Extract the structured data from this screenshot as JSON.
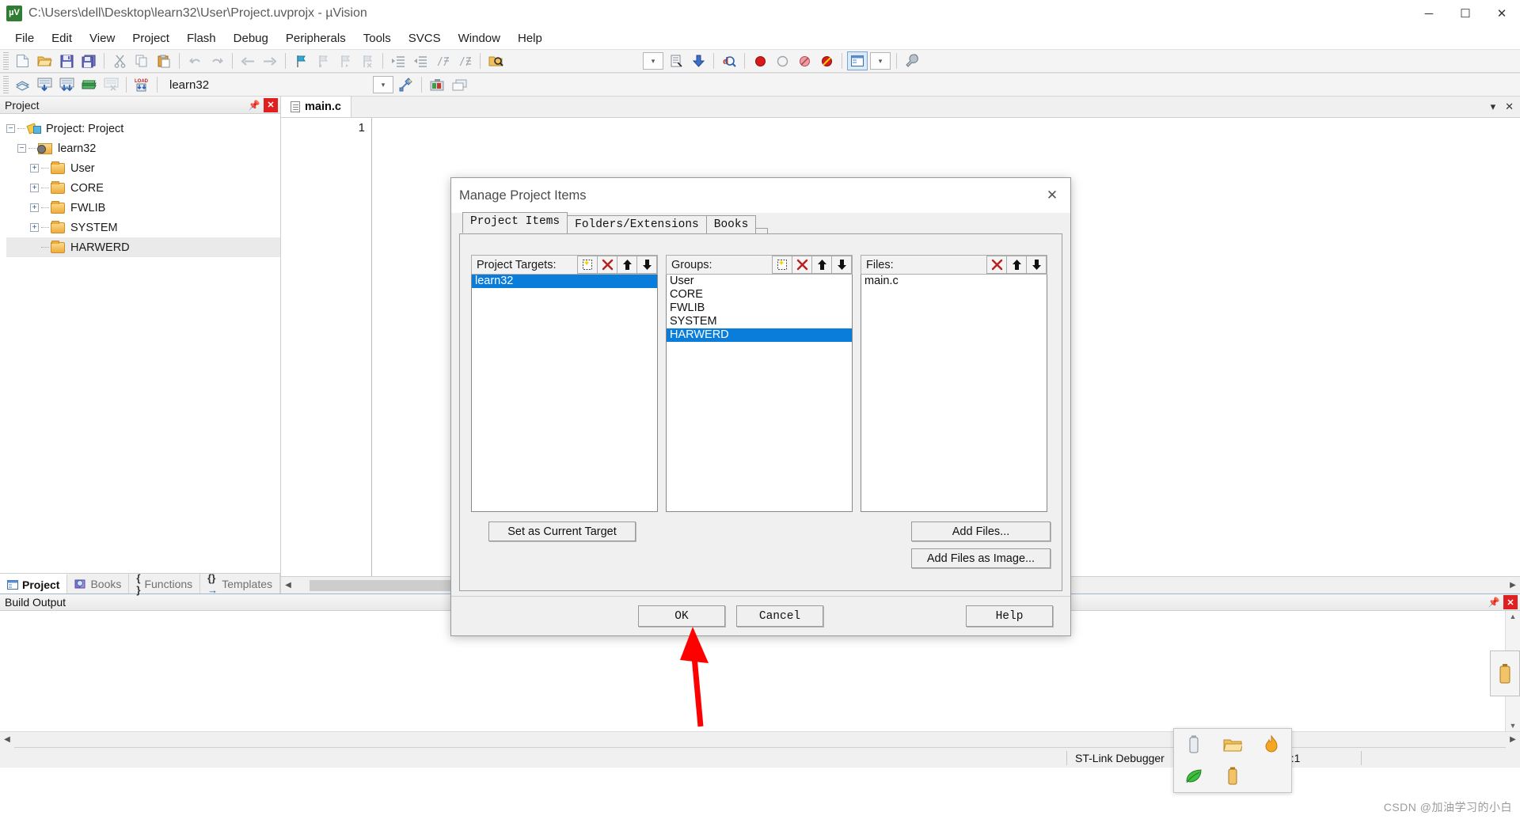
{
  "window": {
    "title": "C:\\Users\\dell\\Desktop\\learn32\\User\\Project.uvprojx - µVision",
    "app_icon": "uvision-icon",
    "minimize": "─",
    "maximize": "☐",
    "close": "✕"
  },
  "menu": {
    "items": [
      "File",
      "Edit",
      "View",
      "Project",
      "Flash",
      "Debug",
      "Peripherals",
      "Tools",
      "SVCS",
      "Window",
      "Help"
    ]
  },
  "toolbar2": {
    "target_value": "learn32"
  },
  "project_pane": {
    "title": "Project",
    "tree": [
      {
        "label": "Project: Project",
        "level": 0,
        "expander": "−",
        "icon": "project-icon",
        "selected": false
      },
      {
        "label": "learn32",
        "level": 1,
        "expander": "−",
        "icon": "target-icon",
        "selected": false
      },
      {
        "label": "User",
        "level": 2,
        "expander": "+",
        "icon": "folder-icon",
        "selected": false
      },
      {
        "label": "CORE",
        "level": 2,
        "expander": "+",
        "icon": "folder-icon",
        "selected": false
      },
      {
        "label": "FWLIB",
        "level": 2,
        "expander": "+",
        "icon": "folder-icon",
        "selected": false
      },
      {
        "label": "SYSTEM",
        "level": 2,
        "expander": "+",
        "icon": "folder-icon",
        "selected": false
      },
      {
        "label": "HARWERD",
        "level": 2,
        "expander": "",
        "icon": "folder-icon",
        "selected": true
      }
    ],
    "tabs": [
      {
        "label": "Project",
        "icon": "project-window-icon",
        "active": true
      },
      {
        "label": "Books",
        "icon": "books-icon",
        "active": false
      },
      {
        "label": "Functions",
        "icon": "braces-icon",
        "active": false
      },
      {
        "label": "Templates",
        "icon": "template-icon",
        "active": false
      }
    ]
  },
  "editor": {
    "tab_label": "main.c",
    "line_numbers": [
      "1"
    ],
    "code_lines": [
      ""
    ]
  },
  "build_output": {
    "title": "Build Output",
    "lines": []
  },
  "status_bar": {
    "debugger": "ST-Link Debugger",
    "position": "1 C:1"
  },
  "dialog": {
    "title": "Manage Project Items",
    "close_label": "✕",
    "tabs": [
      {
        "label": "Project Items",
        "active": true
      },
      {
        "label": "Folders/Extensions",
        "active": false
      },
      {
        "label": "Books",
        "active": false
      }
    ],
    "columns": [
      {
        "header": "Project Targets:",
        "buttons": [
          "new-item-icon",
          "delete-icon",
          "move-up-icon",
          "move-down-icon"
        ],
        "items": [
          {
            "label": "learn32",
            "selected": true
          }
        ]
      },
      {
        "header": "Groups:",
        "buttons": [
          "new-item-icon",
          "delete-icon",
          "move-up-icon",
          "move-down-icon"
        ],
        "items": [
          {
            "label": "User",
            "selected": false
          },
          {
            "label": "CORE",
            "selected": false
          },
          {
            "label": "FWLIB",
            "selected": false
          },
          {
            "label": "SYSTEM",
            "selected": false
          },
          {
            "label": "HARWERD",
            "selected": true
          }
        ]
      },
      {
        "header": "Files:",
        "buttons": [
          "delete-icon",
          "move-up-icon",
          "move-down-icon"
        ],
        "items": [
          {
            "label": "main.c",
            "selected": false
          }
        ]
      }
    ],
    "set_current_target": "Set as Current Target",
    "add_files": "Add Files...",
    "add_files_as_image": "Add Files as Image...",
    "ok": "OK",
    "cancel": "Cancel",
    "help": "Help"
  },
  "annotation": {
    "arrow_color": "#ff0000"
  },
  "float_toolbox": {
    "icons": [
      "usb-device-icon",
      "folder-open-icon",
      "flame-icon",
      "leaf-icon",
      "usb-device-icon-2"
    ]
  },
  "side_dock": {
    "icon": "usb-dock-icon"
  },
  "watermark": "CSDN @加油学习的小白"
}
